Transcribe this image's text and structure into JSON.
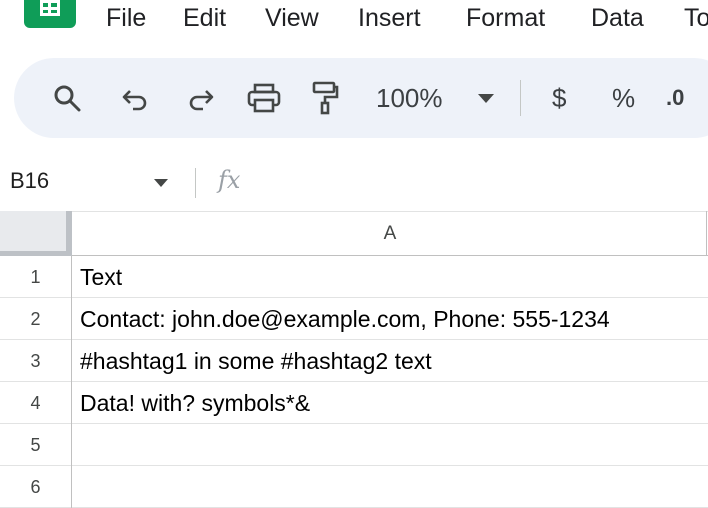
{
  "app": {
    "logo": "google-sheets-logo"
  },
  "menubar": {
    "items": [
      "File",
      "Edit",
      "View",
      "Insert",
      "Format",
      "Data",
      "To"
    ]
  },
  "toolbar": {
    "icons": [
      "search-icon",
      "undo-icon",
      "redo-icon",
      "print-icon",
      "paint-format-icon"
    ],
    "zoom": "100%",
    "currency_label": "$",
    "percent_label": "%",
    "decrease_decimal_label": ".0"
  },
  "formula_bar": {
    "name_box": "B16",
    "fx_label": "fx",
    "formula": ""
  },
  "sheet": {
    "columns": [
      "A"
    ],
    "rows": [
      {
        "number": "1",
        "a": "Text"
      },
      {
        "number": "2",
        "a": "Contact: john.doe@example.com, Phone: 555-1234"
      },
      {
        "number": "3",
        "a": "#hashtag1 in some #hashtag2 text"
      },
      {
        "number": "4",
        "a": "Data! with? symbols*&"
      },
      {
        "number": "5",
        "a": ""
      },
      {
        "number": "6",
        "a": ""
      }
    ]
  }
}
